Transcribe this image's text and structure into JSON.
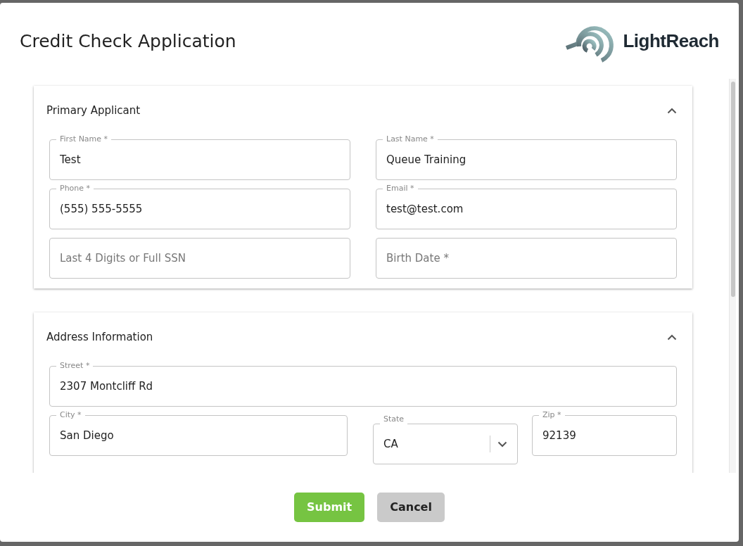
{
  "dialog": {
    "title": "Credit Check Application",
    "logo_text": "LightReach"
  },
  "sections": [
    {
      "title": "Primary Applicant",
      "expanded": true,
      "rows": [
        [
          {
            "kind": "text",
            "label": "First Name *",
            "value": "Test"
          },
          {
            "kind": "text",
            "label": "Last Name *",
            "value": "Queue Training"
          }
        ],
        [
          {
            "kind": "text",
            "label": "Phone *",
            "value": "(555) 555-5555"
          },
          {
            "kind": "text",
            "label": "Email *",
            "value": "test@test.com"
          }
        ],
        [
          {
            "kind": "text",
            "placeholder": "Last 4 Digits or Full SSN"
          },
          {
            "kind": "text",
            "placeholder": "Birth Date *"
          }
        ]
      ]
    },
    {
      "title": "Address Information",
      "expanded": true,
      "rows": [
        [
          {
            "kind": "text",
            "label": "Street *",
            "value": "2307 Montcliff Rd"
          }
        ],
        [
          {
            "kind": "text",
            "label": "City *",
            "value": "San Diego"
          },
          {
            "kind": "select",
            "label": "State",
            "value": "CA"
          },
          {
            "kind": "text",
            "label": "Zip *",
            "value": "92139"
          }
        ]
      ]
    }
  ],
  "buttons": [
    {
      "kind": "primary",
      "label": "Submit"
    },
    {
      "kind": "secondary",
      "label": "Cancel"
    }
  ]
}
